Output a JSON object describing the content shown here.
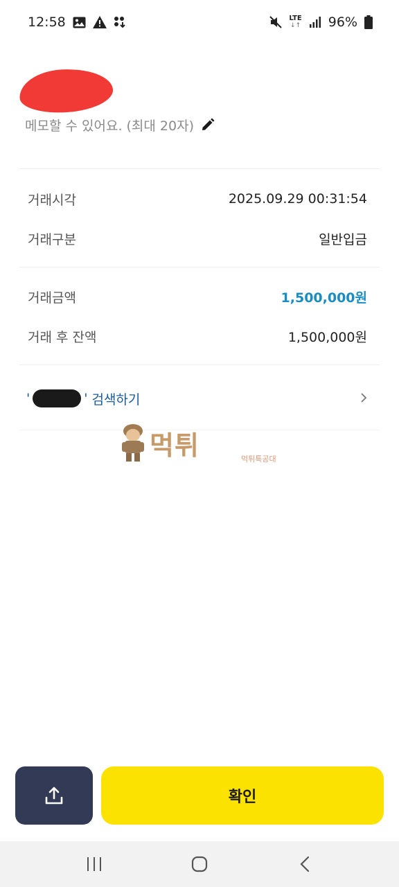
{
  "status_bar": {
    "time": "12:58",
    "network": "LTE",
    "network_arrows": "↓↑",
    "battery": "96%",
    "icons": [
      "gallery-icon",
      "warning-icon",
      "download-icon",
      "mute-icon",
      "signal-icon",
      "battery-icon"
    ]
  },
  "header": {
    "memo_placeholder": "메모할 수 있어요. (최대 20자)",
    "edit_icon": "pencil-icon"
  },
  "details_top": [
    {
      "label": "거래시각",
      "value": "2025.09.29 00:31:54"
    },
    {
      "label": "거래구분",
      "value": "일반입금"
    }
  ],
  "details_amount": [
    {
      "label": "거래금액",
      "value": "1,500,000원"
    },
    {
      "label": "거래 후 잔액",
      "value": "1,500,000원"
    }
  ],
  "search": {
    "quote_open": "'",
    "quote_close": "'",
    "label": "검색하기"
  },
  "watermark": {
    "text": "먹튀",
    "sub": "먹튀특공대"
  },
  "actions": {
    "confirm_label": "확인",
    "upload_icon": "upload-icon"
  },
  "colors": {
    "accent_blue": "#1a8cbf",
    "link_blue": "#1a5b9a",
    "confirm_yellow": "#fbe200",
    "upload_navy": "#323a55",
    "redaction_red": "#f13a35"
  }
}
